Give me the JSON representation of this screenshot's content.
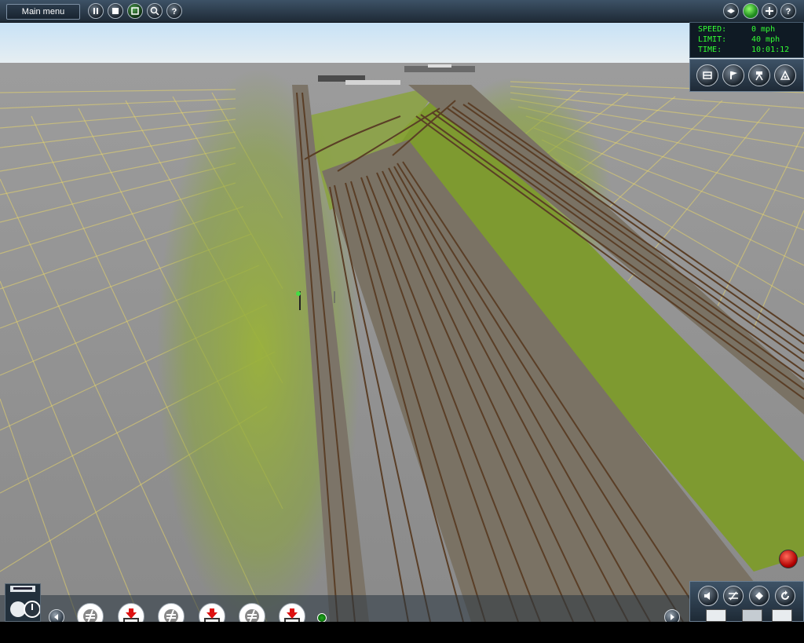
{
  "topbar": {
    "main_menu_label": "Main menu",
    "left_icons": [
      "pause-icon",
      "stop-icon",
      "play-icon",
      "zoom-icon",
      "help-icon"
    ],
    "right_icons": [
      "layers-icon",
      "status-light-icon",
      "add-icon",
      "help-icon"
    ]
  },
  "hud": {
    "speed_label": "SPEED:",
    "speed_value": "0 mph",
    "limit_label": "LIMIT:",
    "limit_value": "40 mph",
    "time_label": "TIME:",
    "time_value": "10:01:12"
  },
  "camera_panel": {
    "icons": [
      "cab-camera-icon",
      "track-camera-icon",
      "tripod-camera-icon",
      "free-roam-camera-icon"
    ]
  },
  "bottom_toolbar": {
    "tools": [
      "no-entry-icon",
      "download-red-icon",
      "no-entry-icon",
      "download-red-icon",
      "no-entry-icon",
      "download-red-icon"
    ]
  },
  "bottom_right_panel": {
    "icons": [
      "sound-icon",
      "switch-icon",
      "diamond-icon",
      "refresh-icon"
    ]
  },
  "colors": {
    "hud_text": "#33ff33",
    "panel_dark": "#1e2a36",
    "panel_light": "#3d5266",
    "grass": "#8aa43a",
    "ground_grey": "#8a8a8a",
    "grid_yellow": "#f0e060",
    "rail_brown": "#6b4a2e",
    "sky": "#cfe6f4"
  }
}
